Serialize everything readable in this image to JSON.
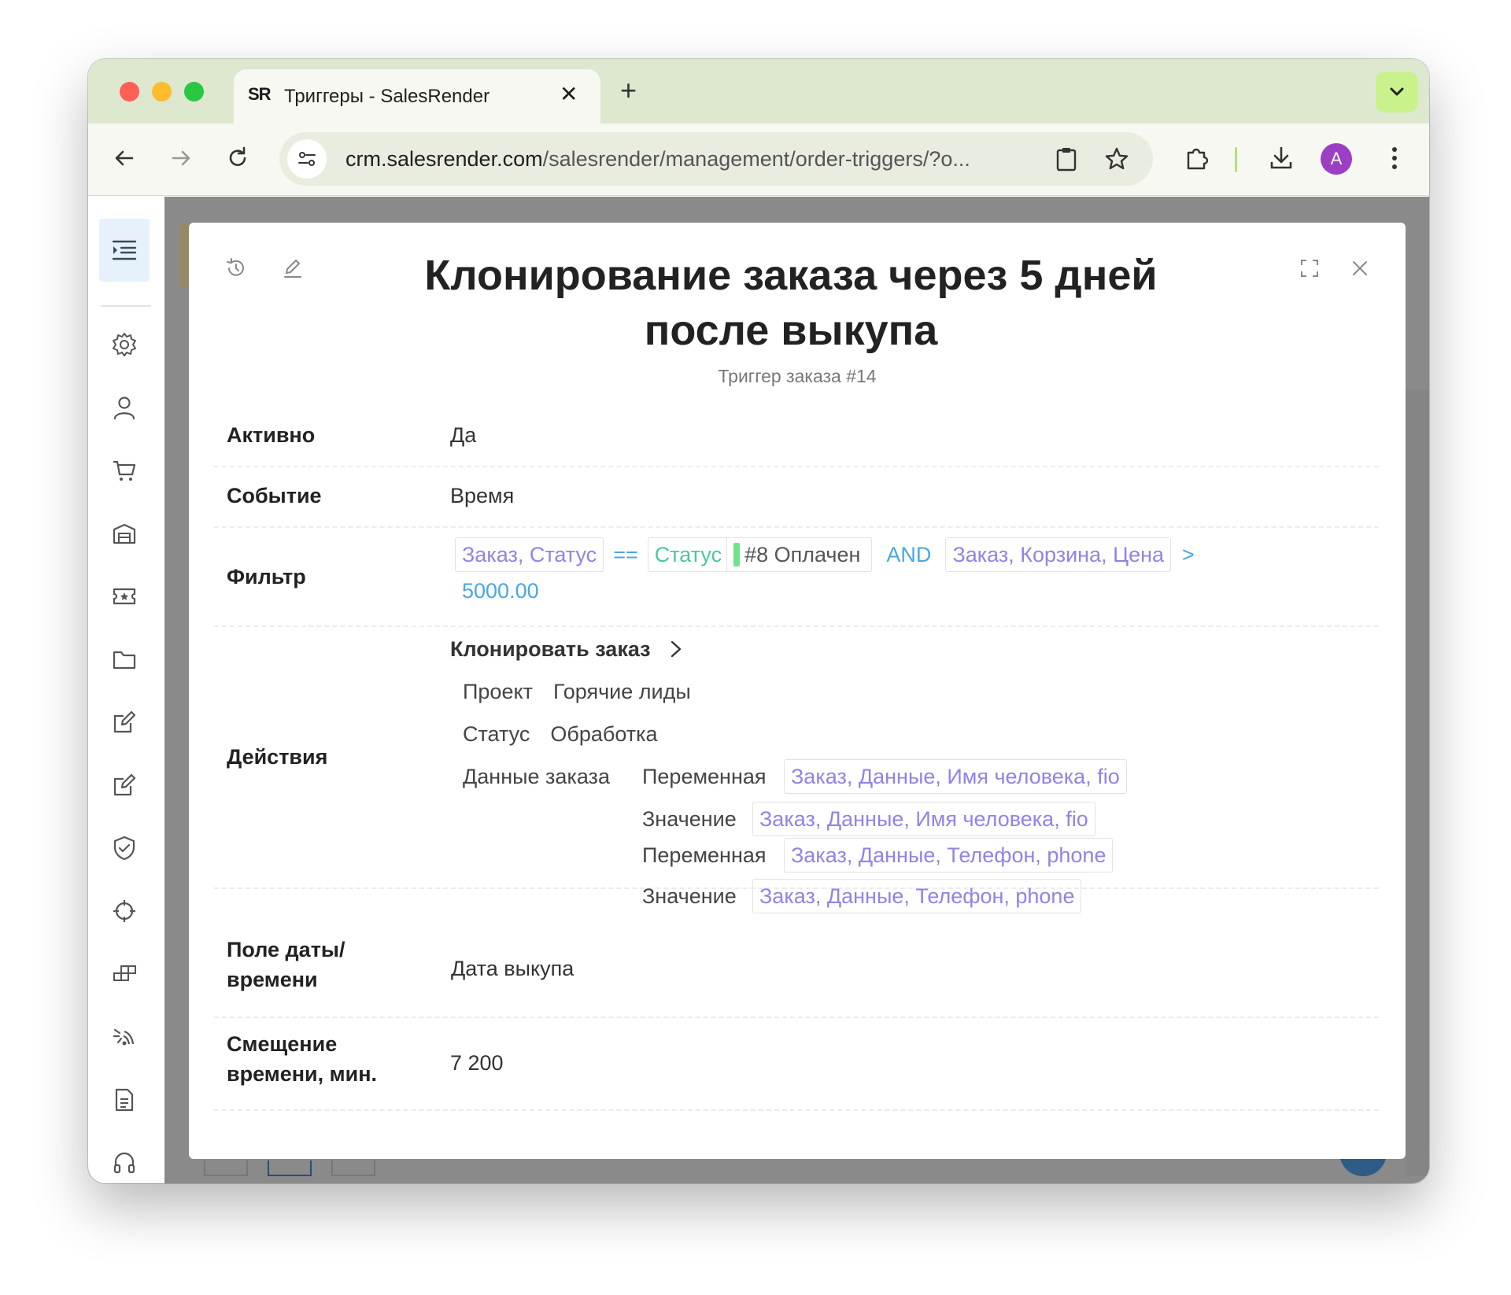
{
  "browser": {
    "tab_title": "Триггеры - SalesRender",
    "tab_favicon": "SR",
    "url_host": "crm.salesrender.com",
    "url_path": "/salesrender/management/order-triggers/?o...",
    "avatar_letter": "A",
    "accent_color": "#c9f28c"
  },
  "modal": {
    "title": "Клонирование заказа через 5 дней после выкупа",
    "subtitle": "Триггер заказа #14",
    "rows": {
      "active": {
        "label": "Активно",
        "value": "Да"
      },
      "event": {
        "label": "Событие",
        "value": "Время"
      },
      "filter": {
        "label": "Фильтр",
        "chip1": "Заказ, Статус",
        "op1": "==",
        "chip2_key": "Статус",
        "chip2_value": "#8 Оплачен",
        "op2": "AND",
        "chip3": "Заказ, Корзина, Цена",
        "op3": ">",
        "number": "5000.00"
      },
      "actions": {
        "label": "Действия",
        "action_title": "Клонировать заказ",
        "project_label": "Проект",
        "project_value": "Горячие лиды",
        "status_label": "Статус",
        "status_value": "Обработка",
        "order_data_label": "Данные заказа",
        "pairs": [
          {
            "var_label": "Переменная",
            "var_value": "Заказ, Данные, Имя человека, fio",
            "val_label": "Значение",
            "val_value": "Заказ, Данные, Имя человека, fio"
          },
          {
            "var_label": "Переменная",
            "var_value": "Заказ, Данные, Телефон, phone",
            "val_label": "Значение",
            "val_value": "Заказ, Данные, Телефон, phone"
          }
        ]
      },
      "date_field": {
        "label_line1": "Поле даты/",
        "label_line2": "времени",
        "value": "Дата выкупа"
      },
      "offset": {
        "label_line1": "Смещение",
        "label_line2": "времени, мин.",
        "value": "7 200"
      }
    }
  },
  "colors": {
    "chip_text": "#8e84e8",
    "operator": "#4aa7e3",
    "status_green": "#4cc79f"
  },
  "icons": {
    "sidebar": [
      "settings-icon",
      "user-icon",
      "cart-icon",
      "warehouse-icon",
      "ticket-icon",
      "folder-icon",
      "edit-icon",
      "edit-icon-2",
      "shield-check-icon",
      "crosshair-icon",
      "blocks-icon",
      "signal-icon",
      "document-icon",
      "headset-icon"
    ]
  }
}
